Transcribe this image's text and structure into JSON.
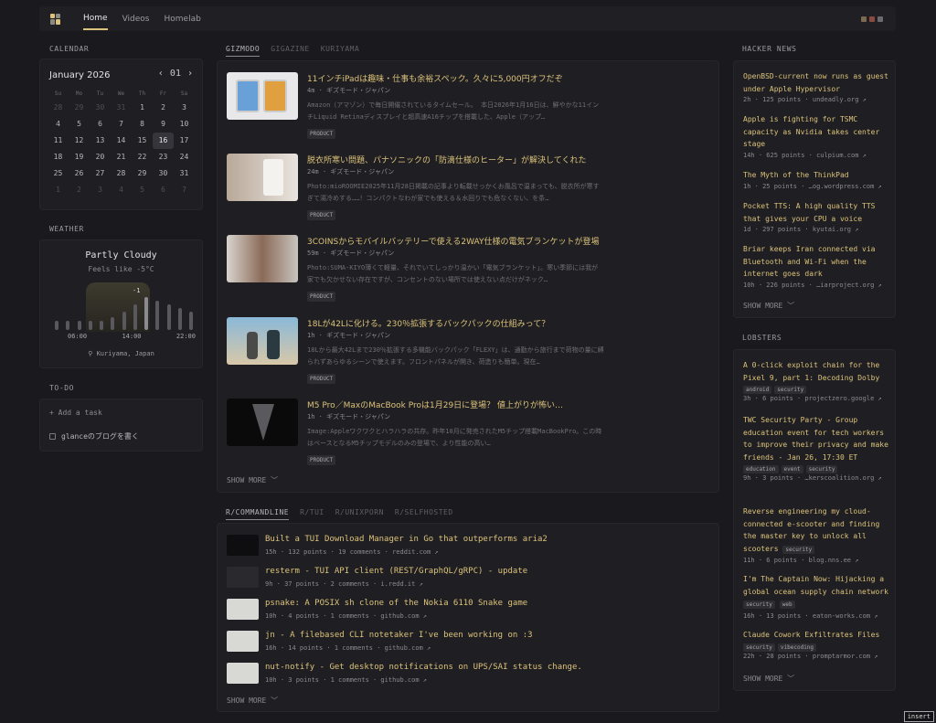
{
  "nav": {
    "items": [
      "Home",
      "Videos",
      "Homelab"
    ]
  },
  "calendar": {
    "title": "CALENDAR",
    "month": "January 2026",
    "week": "01",
    "prev": "‹",
    "next": "›",
    "weekdays": [
      "Su",
      "Mo",
      "Tu",
      "We",
      "Th",
      "Fr",
      "Sa"
    ],
    "days": [
      "28",
      "29",
      "30",
      "31",
      "1",
      "2",
      "3",
      "4",
      "5",
      "6",
      "7",
      "8",
      "9",
      "10",
      "11",
      "12",
      "13",
      "14",
      "15",
      "16",
      "17",
      "18",
      "19",
      "20",
      "21",
      "22",
      "23",
      "24",
      "25",
      "26",
      "27",
      "28",
      "29",
      "30",
      "31",
      "1",
      "2",
      "3",
      "4",
      "5",
      "6",
      "7"
    ],
    "today": "16"
  },
  "weather": {
    "title": "WEATHER",
    "condition": "Partly Cloudy",
    "feels": "Feels like -5°C",
    "temp": "-1",
    "hours": [
      "06:00",
      "14:00",
      "22:00"
    ],
    "location": "Kuriyama, Japan",
    "bars": [
      0.25,
      0.25,
      0.25,
      0.25,
      0.25,
      0.35,
      0.5,
      0.7,
      0.9,
      0.8,
      0.7,
      0.6,
      0.5
    ]
  },
  "todo": {
    "title": "TO-DO",
    "add": "+  Add a task",
    "items": [
      "glanceのブログを書く"
    ]
  },
  "news": {
    "tabs": [
      "GIZMODO",
      "GIGAZINE",
      "KURIYAMA"
    ],
    "articles": [
      {
        "title": "11インチiPadは趣味・仕事も余裕スペック。久々に5,000円オフだぞ",
        "meta": "4m · ギズモード・ジャパン",
        "desc": "Amazon（アマゾン）で毎日開催されているタイムセール。 本日2026年1月16日は、鮮やかな11インチLiquid Retinaディスプレイと超高速A16チップを搭載した、Apple（アップ…",
        "tag": "PRODUCT"
      },
      {
        "title": "脱衣所寒い問題、パナソニックの「防滴仕様のヒーター」が解決してくれた",
        "meta": "24m · ギズモード・ジャパン",
        "desc": "Photo:mioROOMIE2025年11月28日掲載の記事より転載せっかくお風呂で温まっても、脱衣所が寒すぎて湯冷めする……！コンパクトなわが家でも使える＆水回りでも危なくない、を条…",
        "tag": "PRODUCT"
      },
      {
        "title": "3COINSからモバイルバッテリーで使える2WAY仕様の電気ブランケットが登場",
        "meta": "59m · ギズモード・ジャパン",
        "desc": "Photo:SUMA-KIYO薄くて軽量、それでいてしっかり温かい「電気ブランケット」。寒い季節には我が家でも欠かせない存在ですが、コンセントのない場所では使えない点だけがネック…",
        "tag": "PRODUCT"
      },
      {
        "title": "18Lが42Lに化ける。230％拡張するバックパックの仕組みって？",
        "meta": "1h · ギズモード・ジャパン",
        "desc": "18Lから最大42Lまで230％拡張する多機能バックパック「FLEXY」は、通勤から旅行まで荷物の量に縛られずあらゆるシーンで使えます。フロントパネルが開き、荷造りも簡単。現在…",
        "tag": "PRODUCT"
      },
      {
        "title": "M5 Pro／MaxのMacBook Proは1月29日に登場？ 値上がりが怖い…",
        "meta": "1h · ギズモード・ジャパン",
        "desc": "Image:Appleワクワクとハラハラの共存。昨年10月に発売されたM5チップ搭載MacBookPro。この時はベースとなるM5チップモデルのみの登場で、より性能の高い…",
        "tag": "PRODUCT"
      }
    ],
    "show_more": "SHOW MORE ﹀"
  },
  "reddit": {
    "tabs": [
      "R/COMMANDLINE",
      "R/TUI",
      "R/UNIXPORN",
      "R/SELFHOSTED"
    ],
    "posts": [
      {
        "title": "Built a TUI Download Manager in Go that outperforms aria2",
        "meta": "15h · 132 points · 19 comments · reddit.com ↗"
      },
      {
        "title": "resterm - TUI API client (REST/GraphQL/gRPC) - update",
        "meta": "9h · 37 points · 2 comments · i.redd.it ↗"
      },
      {
        "title": "psnake: A POSIX sh clone of the Nokia 6110 Snake game",
        "meta": "10h · 4 points · 1 comments · github.com ↗"
      },
      {
        "title": "jn - A filebased CLI notetaker I've been working on :3",
        "meta": "16h · 14 points · 1 comments · github.com ↗"
      },
      {
        "title": "nut-notify - Get desktop notifications on UPS/SAI status change.",
        "meta": "10h · 3 points · 1 comments · github.com ↗"
      }
    ],
    "show_more": "SHOW MORE ﹀"
  },
  "hn": {
    "title": "HACKER NEWS",
    "items": [
      {
        "title": "OpenBSD-current now runs as guest under Apple Hypervisor",
        "meta": "2h · 125 points · undeadly.org ↗"
      },
      {
        "title": "Apple is fighting for TSMC capacity as Nvidia takes center stage",
        "meta": "14h · 625 points · culpium.com ↗"
      },
      {
        "title": "The Myth of the ThinkPad",
        "meta": "1h · 25 points · …og.wordpress.com ↗"
      },
      {
        "title": "Pocket TTS: A high quality TTS that gives your CPU a voice",
        "meta": "1d · 297 points · kyutai.org ↗"
      },
      {
        "title": "Briar keeps Iran connected via Bluetooth and Wi-Fi when the internet goes dark",
        "meta": "10h · 226 points · …iarproject.org ↗"
      }
    ],
    "show_more": "SHOW MORE ﹀"
  },
  "lobsters": {
    "title": "LOBSTERS",
    "items": [
      {
        "title": "A 0-click exploit chain for the Pixel 9, part 1: Decoding Dolby",
        "tags": [
          "android",
          "security"
        ],
        "meta": "3h · 6 points · projectzero.google ↗"
      },
      {
        "title": "TWC Security Party - Group education event for tech workers to improve their privacy and make friends - Jan 26, 17:30 ET",
        "tags": [
          "education",
          "event",
          "security"
        ],
        "meta": "9h · 3 points · …kerscoalition.org ↗"
      },
      {
        "title": "Reverse engineering my cloud-connected e-scooter and finding the master key to unlock all scooters",
        "tags": [
          "security"
        ],
        "meta": "11h · 6 points · blog.nns.ee ↗"
      },
      {
        "title": "I'm The Captain Now: Hijacking a global ocean supply chain network",
        "tags": [
          "security",
          "web"
        ],
        "meta": "16h · 13 points · eaton-works.com ↗"
      },
      {
        "title": "Claude Cowork Exfiltrates Files",
        "tags": [
          "security",
          "vibecoding"
        ],
        "meta": "22h · 28 points · promptarmor.com ↗"
      }
    ],
    "show_more": "SHOW MORE ﹀"
  },
  "status": {
    "mode": "insert"
  },
  "colors": {
    "accent": "#dcc27a",
    "background": "#1a1a1e",
    "panel": "#1f1f23"
  }
}
